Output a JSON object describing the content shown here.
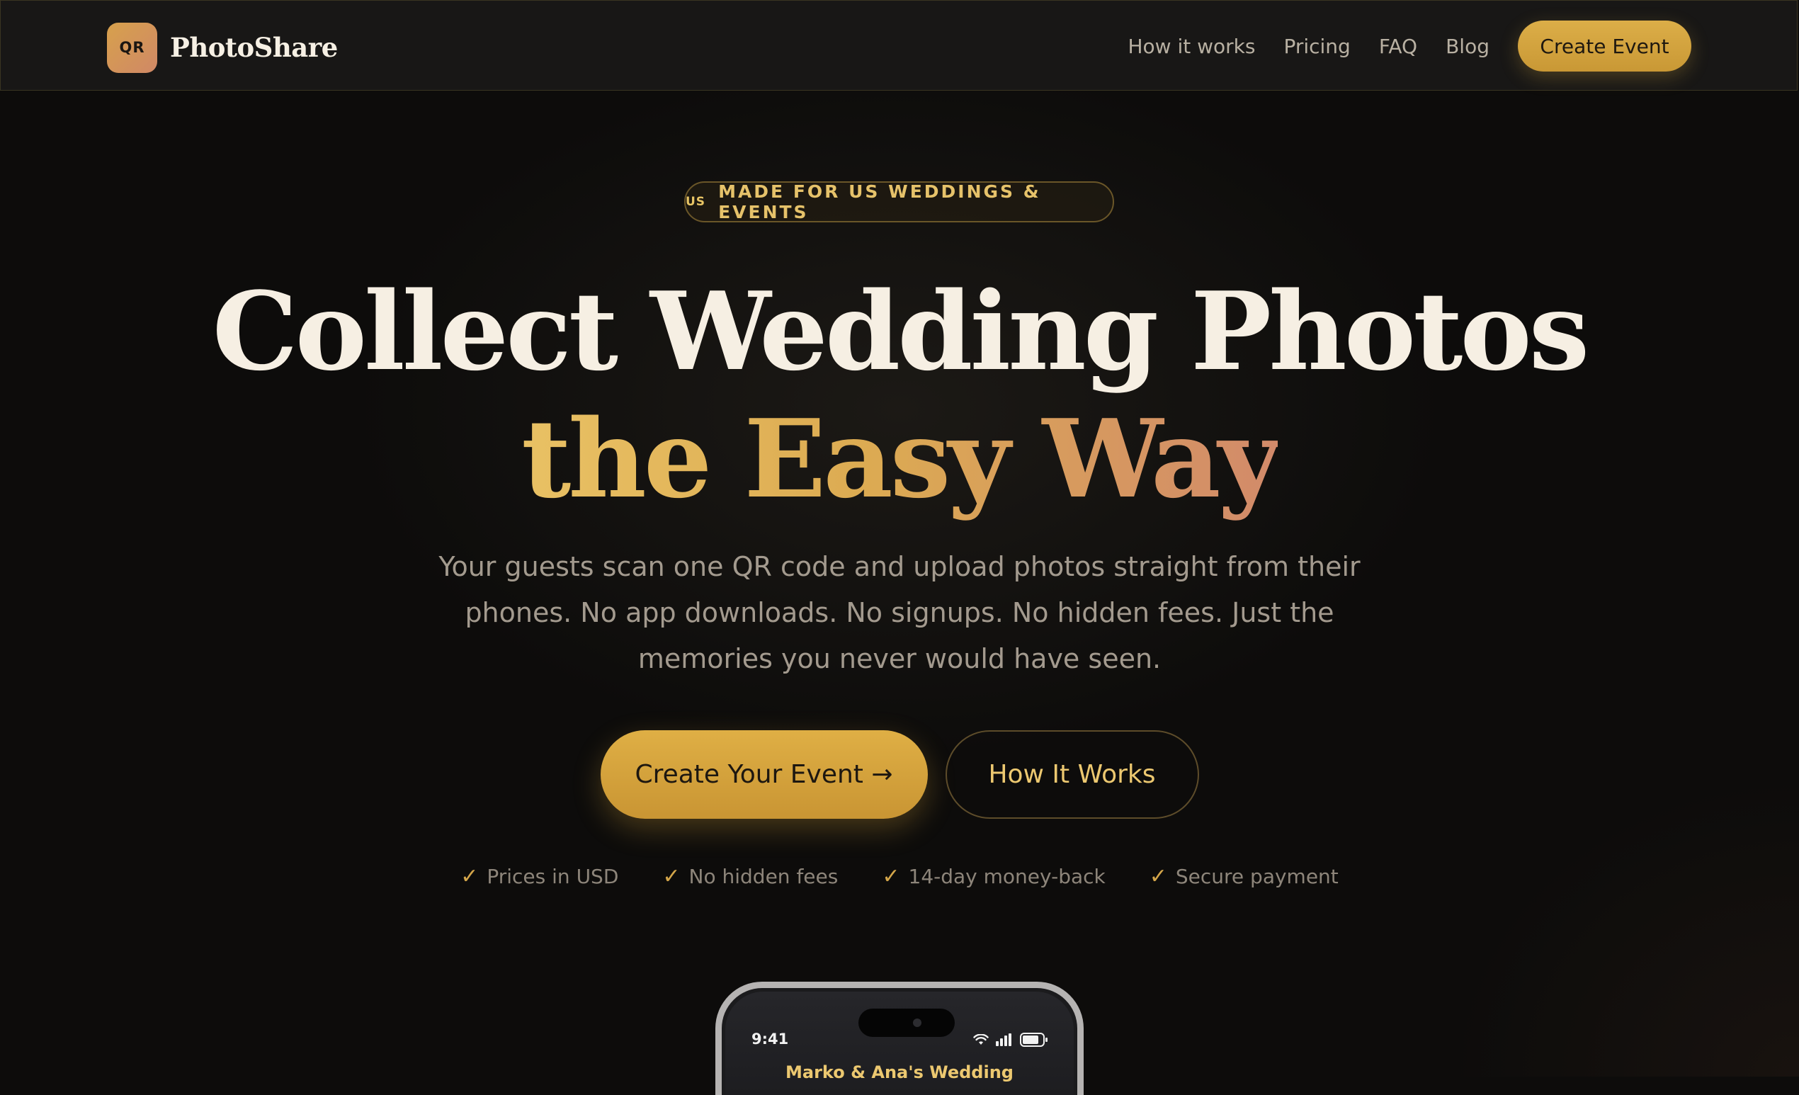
{
  "nav": {
    "logo_badge": "QR",
    "logo_text": "PhotoShare",
    "links": [
      "How it works",
      "Pricing",
      "FAQ",
      "Blog"
    ],
    "cta_label": "Create Event"
  },
  "hero": {
    "badge_flag": "US",
    "badge_text": "MADE FOR US WEDDINGS & EVENTS",
    "headline_line1": "Collect Wedding Photos",
    "headline_line2": "the Easy Way",
    "subtitle": "Your guests scan one QR code and upload photos straight from their phones. No app downloads. No signups. No hidden fees. Just the memories you never would have seen.",
    "primary_cta": "Create Your Event →",
    "secondary_cta": "How It Works",
    "trust_items": [
      "Prices in USD",
      "No hidden fees",
      "14-day money-back",
      "Secure payment"
    ],
    "check_glyph": "✓"
  },
  "phone": {
    "time": "9:41",
    "event_title": "Marko & Ana's Wedding"
  },
  "colors": {
    "background": "#0d0c0b",
    "accent_gold": "#dcae48",
    "accent_copper": "#d28a6a",
    "text_primary": "#f6efe3",
    "text_muted": "#a39a8e"
  },
  "icons": {
    "logo": "qr-logo-icon",
    "check": "check-icon",
    "wifi": "wifi-icon",
    "signal": "signal-icon",
    "battery": "battery-icon"
  }
}
